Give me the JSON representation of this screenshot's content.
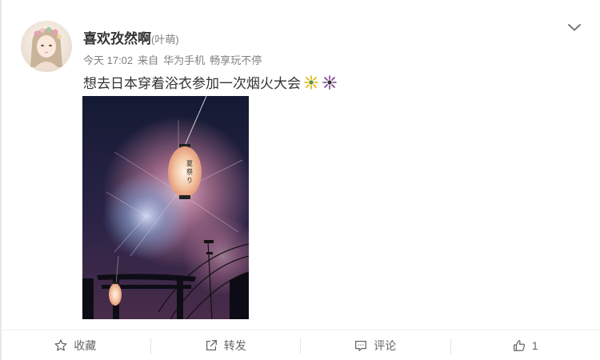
{
  "post": {
    "user_name": "喜欢孜然啊",
    "user_remark": "(叶萌)",
    "time": "今天 17:02",
    "source_prefix": "来自",
    "source_device": "华为手机",
    "source_slogan": "畅享玩不停",
    "text": "想去日本穿着浴衣参加一次烟火大会",
    "emoji": [
      "firework-yellow-icon",
      "firework-purple-icon"
    ],
    "photo": {
      "lantern_text": "夏 祭 り"
    }
  },
  "footer": {
    "favorite_label": "收藏",
    "repost_label": "转发",
    "comment_label": "评论",
    "like_count": "1"
  },
  "colors": {
    "text_primary": "#333333",
    "text_meta": "#808080",
    "icon": "#666666",
    "night_sky": "#1a1f3a",
    "firework_pink": "#d98aa8",
    "firework_blue": "#7fa6d8",
    "lantern": "#f3c6a4"
  }
}
